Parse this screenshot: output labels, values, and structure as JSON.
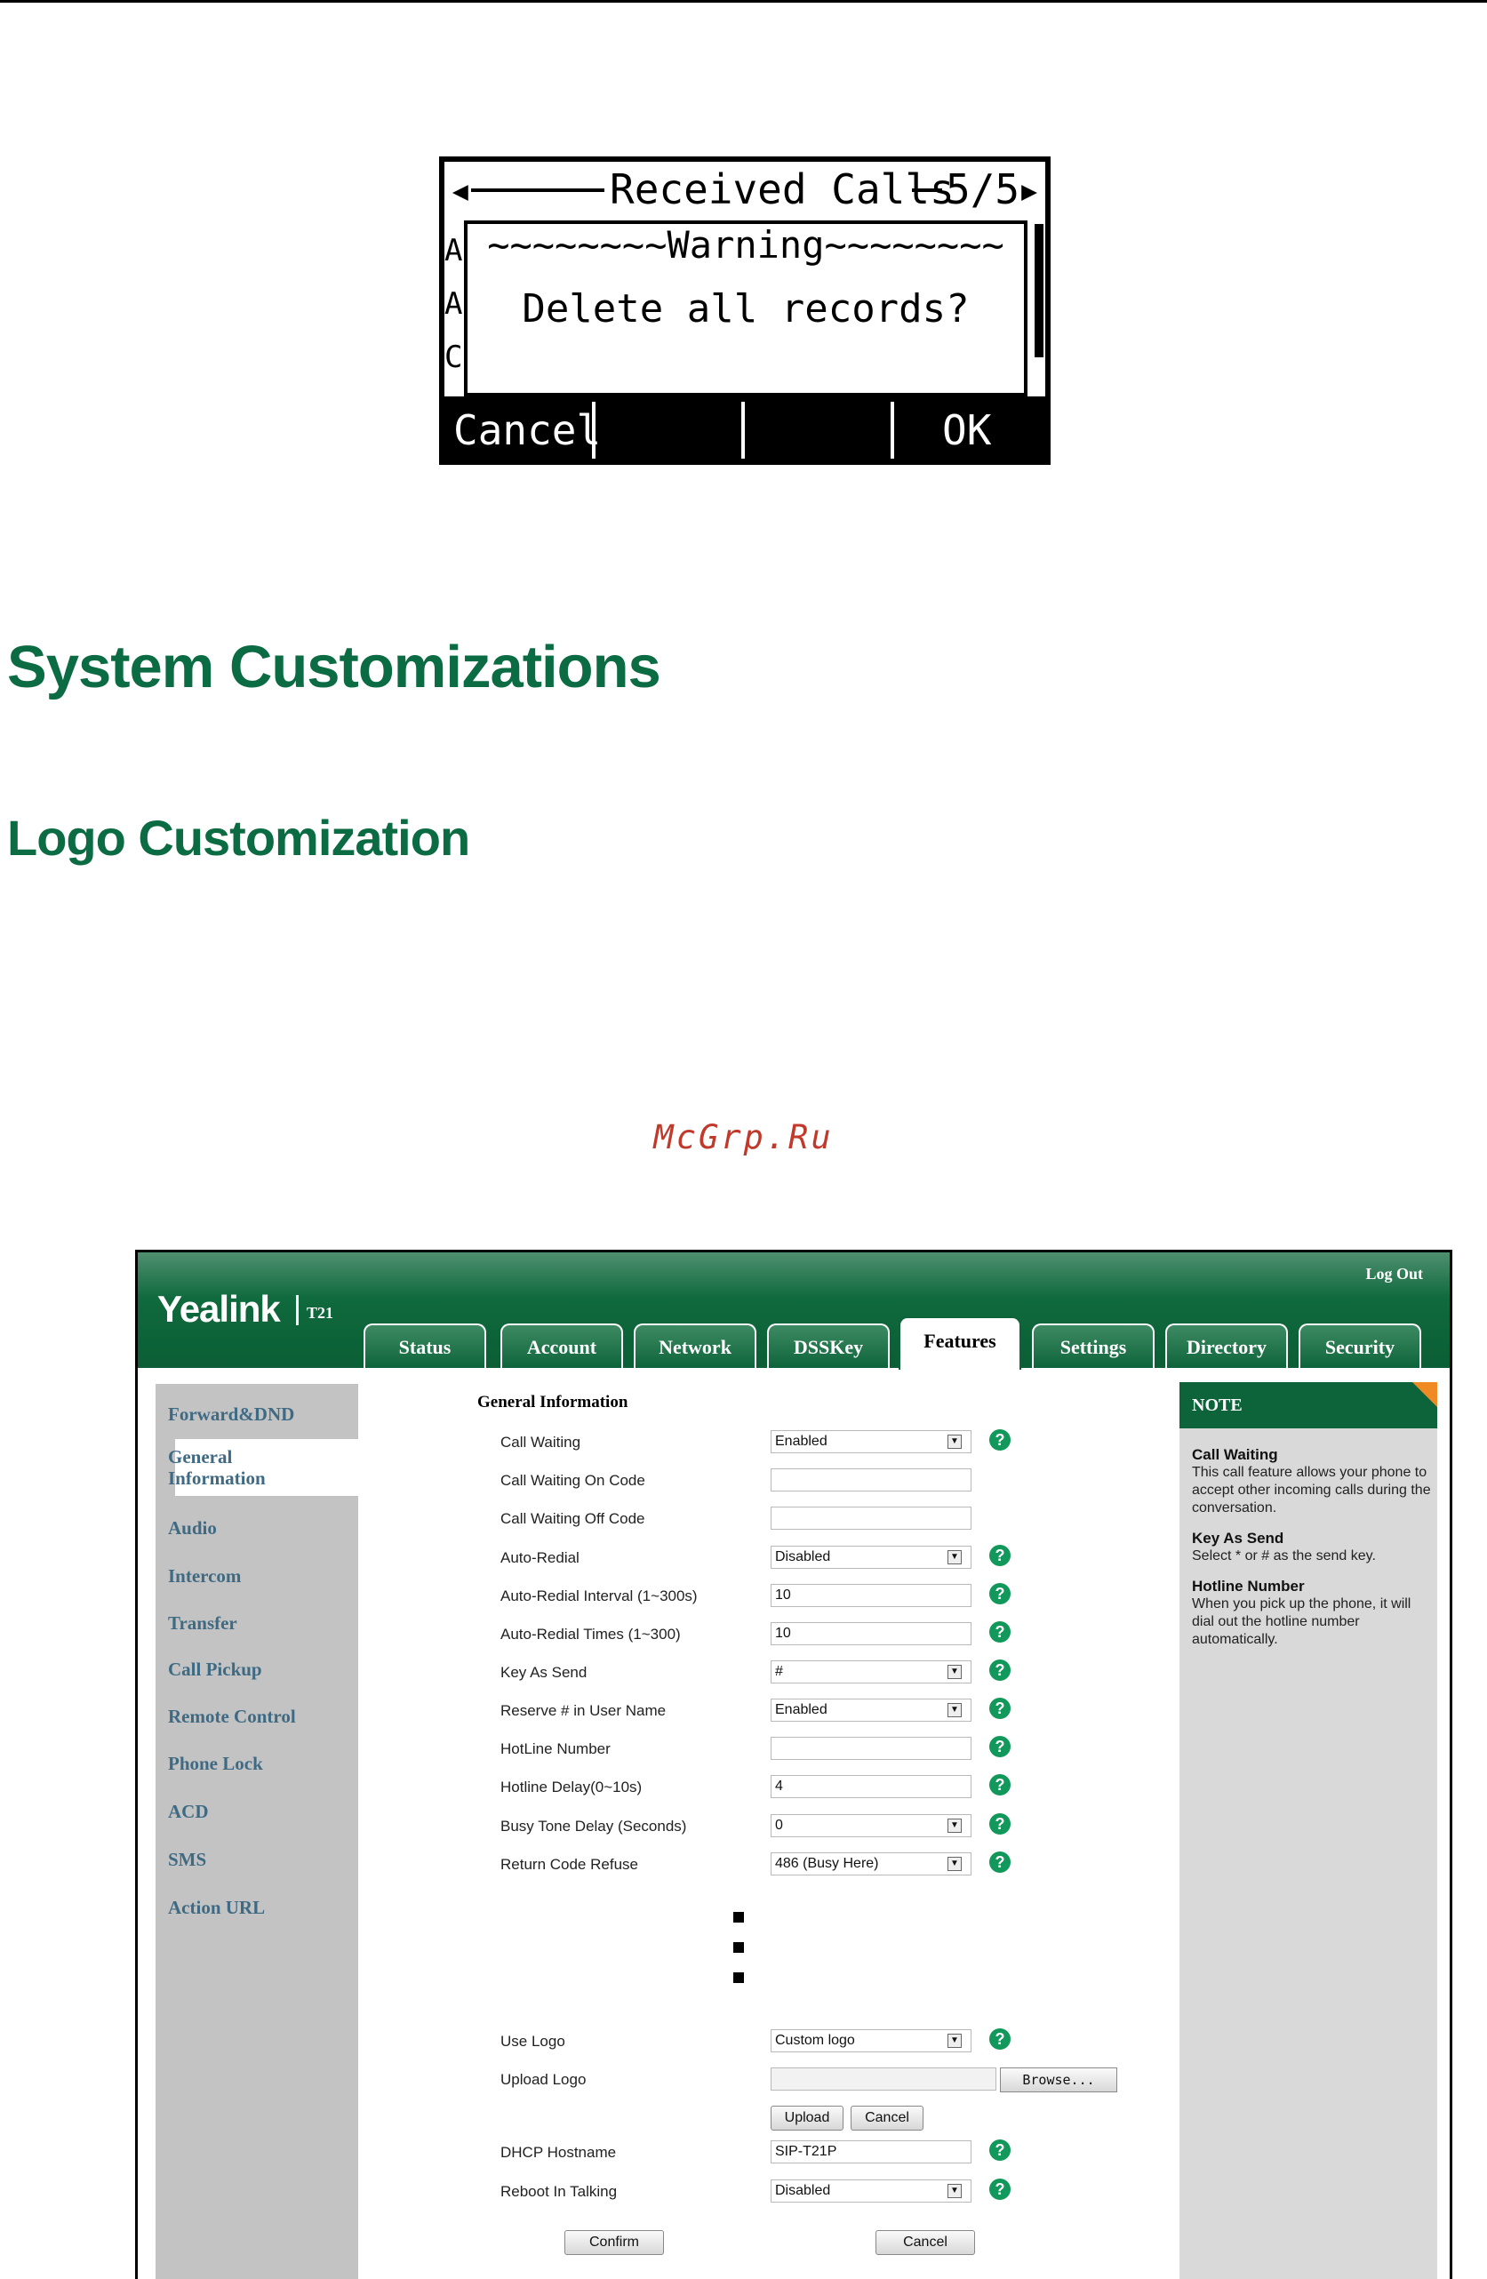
{
  "lcd": {
    "title": "Received Calls",
    "page": "5/5",
    "warning": "~~~~~~~~Warning~~~~~~~~",
    "message": "Delete all records?",
    "edge_letters": [
      "A",
      "A",
      "C"
    ],
    "softkeys": [
      "Cancel",
      "",
      "",
      "OK"
    ]
  },
  "headings": {
    "h1": "System Customizations",
    "h2": "Logo Customization"
  },
  "watermark": "McGrp.Ru",
  "web": {
    "logo": "Yealink",
    "model": "T21",
    "logout": "Log Out",
    "tabs": [
      "Status",
      "Account",
      "Network",
      "DSSKey",
      "Features",
      "Settings",
      "Directory",
      "Security"
    ],
    "active_tab": "Features",
    "sidebar": [
      "Forward&DND",
      "General\nInformation",
      "Audio",
      "Intercom",
      "Transfer",
      "Call Pickup",
      "Remote Control",
      "Phone Lock",
      "ACD",
      "SMS",
      "Action URL"
    ],
    "section_title": "General Information",
    "rows": [
      {
        "label": "Call Waiting",
        "value": "Enabled",
        "type": "select",
        "help": true
      },
      {
        "label": "Call Waiting On Code",
        "value": "",
        "type": "text",
        "help": false
      },
      {
        "label": "Call Waiting Off Code",
        "value": "",
        "type": "text",
        "help": false
      },
      {
        "label": "Auto-Redial",
        "value": "Disabled",
        "type": "select",
        "help": true
      },
      {
        "label": "Auto-Redial Interval (1~300s)",
        "value": "10",
        "type": "text",
        "help": true
      },
      {
        "label": "Auto-Redial Times (1~300)",
        "value": "10",
        "type": "text",
        "help": true
      },
      {
        "label": "Key As Send",
        "value": "#",
        "type": "select",
        "help": true
      },
      {
        "label": "Reserve # in User Name",
        "value": "Enabled",
        "type": "select",
        "help": true
      },
      {
        "label": "HotLine Number",
        "value": "",
        "type": "text",
        "help": true
      },
      {
        "label": "Hotline Delay(0~10s)",
        "value": "4",
        "type": "text",
        "help": true
      },
      {
        "label": "Busy Tone Delay (Seconds)",
        "value": "0",
        "type": "select",
        "help": true
      },
      {
        "label": "Return Code Refuse",
        "value": "486 (Busy Here)",
        "type": "select",
        "help": true
      }
    ],
    "use_logo": {
      "label": "Use Logo",
      "value": "Custom logo"
    },
    "upload_logo": {
      "label": "Upload Logo",
      "value": "",
      "browse": "Browse..."
    },
    "upload_button": "Upload",
    "cancel_small_button": "Cancel",
    "dhcp_hostname": {
      "label": "DHCP Hostname",
      "value": "SIP-T21P"
    },
    "reboot_in_talking": {
      "label": "Reboot In Talking",
      "value": "Disabled"
    },
    "confirm_button": "Confirm",
    "cancel_button": "Cancel",
    "note": {
      "title": "NOTE",
      "items": [
        {
          "title": "Call Waiting",
          "text": "This call feature allows your phone to accept other incoming calls during the conversation."
        },
        {
          "title": "Key As Send",
          "text": "Select * or # as the send key."
        },
        {
          "title": "Hotline Number",
          "text": "When you pick up the phone, it will dial out the hotline number automatically."
        }
      ]
    }
  }
}
